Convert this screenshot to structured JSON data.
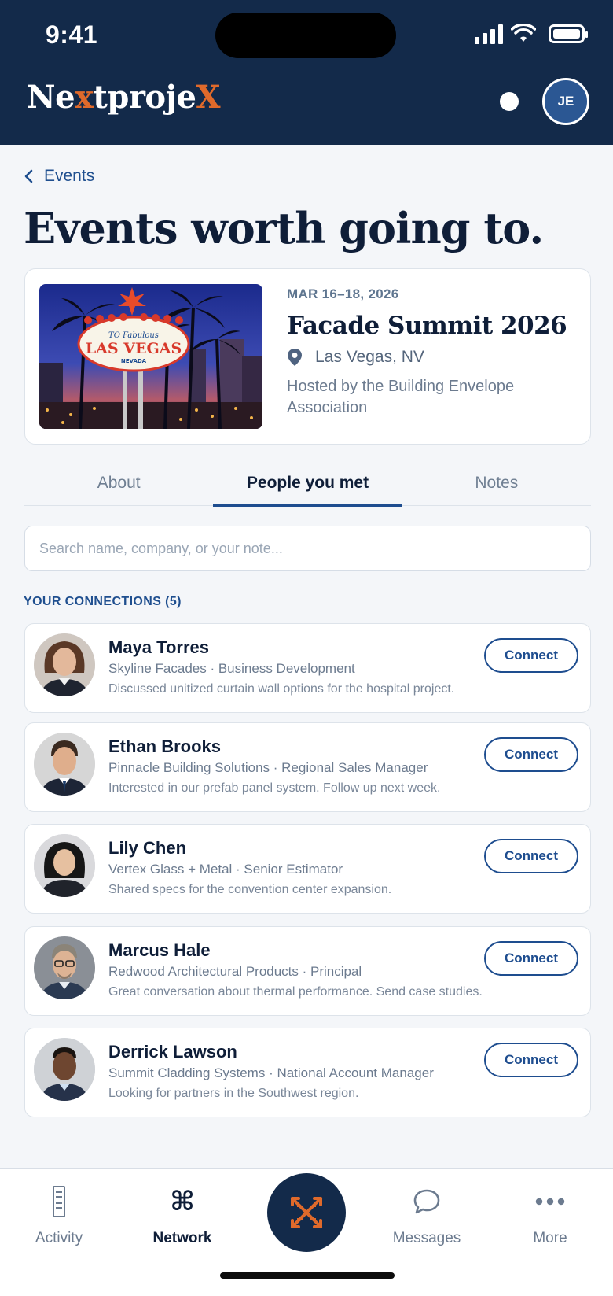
{
  "status_bar": {
    "time": "9:41"
  },
  "header": {
    "logo": {
      "part1": "Ne",
      "part2": "x",
      "part3": "tproje",
      "part4": "X"
    },
    "avatar_initials": "JE"
  },
  "back_link": {
    "label": "Events"
  },
  "page_title": "Events worth going to.",
  "event": {
    "date": "MAR 16–18, 2026",
    "name": "Facade Summit 2026",
    "location": "Las Vegas, NV",
    "host": "Hosted by the Building Envelope Association",
    "image_sign_top": "TO Fabulous",
    "image_sign_main": "LAS VEGAS",
    "image_sign_bottom": "NEVADA"
  },
  "tabs": [
    {
      "label": "About",
      "active": false
    },
    {
      "label": "People you met",
      "active": true
    },
    {
      "label": "Notes",
      "active": false
    }
  ],
  "search": {
    "placeholder": "Search name, company, or your note..."
  },
  "connections_label": "YOUR CONNECTIONS (5)",
  "connections": [
    {
      "name": "Maya Torres",
      "role": "Skyline Facades · Business Development",
      "note": "Discussed unitized curtain wall options for the hospital project.",
      "button": "Connect"
    },
    {
      "name": "Ethan Brooks",
      "role": "Pinnacle Building Solutions · Regional Sales Manager",
      "note": "Interested in our prefab panel system. Follow up next week.",
      "button": "Connect"
    },
    {
      "name": "Lily Chen",
      "role": "Vertex Glass + Metal · Senior Estimator",
      "note": "Shared specs for the convention center expansion.",
      "button": "Connect"
    },
    {
      "name": "Marcus Hale",
      "role": "Redwood Architectural Products · Principal",
      "note": "Great conversation about thermal performance. Send case studies.",
      "button": "Connect"
    },
    {
      "name": "Derrick Lawson",
      "role": "Summit Cladding Systems · National Account Manager",
      "note": "Looking for partners in the Southwest region.",
      "button": "Connect"
    }
  ],
  "bottom_nav": [
    {
      "label": "Activity",
      "icon": "activity-icon"
    },
    {
      "label": "Network",
      "icon": "command-icon",
      "active": true
    },
    {
      "label": "",
      "icon": "nextprojex-x-icon"
    },
    {
      "label": "Messages",
      "icon": "chat-bubble-icon"
    },
    {
      "label": "More",
      "icon": "more-dots-icon"
    }
  ],
  "colors": {
    "header_bg": "#132a4a",
    "accent": "#1e4d8f",
    "brand_orange": "#e06a2b"
  }
}
